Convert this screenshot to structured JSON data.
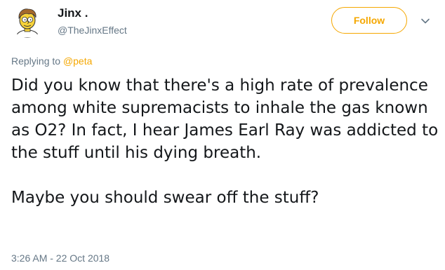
{
  "user": {
    "display_name": "Jinx .",
    "handle": "@TheJinxEffect",
    "avatar_icon": "cartoon-character-avatar-icon"
  },
  "header": {
    "follow_label": "Follow",
    "menu_icon": "chevron-down-icon"
  },
  "reply": {
    "prefix": "Replying to ",
    "mention": "@peta"
  },
  "tweet": {
    "paragraph_1": "Did you know that there's a high rate of prevalence among white supremacists to inhale the gas known as O2? In fact, I hear James Earl Ray was addicted to the stuff until his dying breath.",
    "paragraph_2": "Maybe you should swear off the stuff?"
  },
  "meta": {
    "timestamp": "3:26 AM - 22 Oct 2018"
  },
  "colors": {
    "accent": "#f5a700",
    "text": "#14171a",
    "secondary": "#657786"
  }
}
